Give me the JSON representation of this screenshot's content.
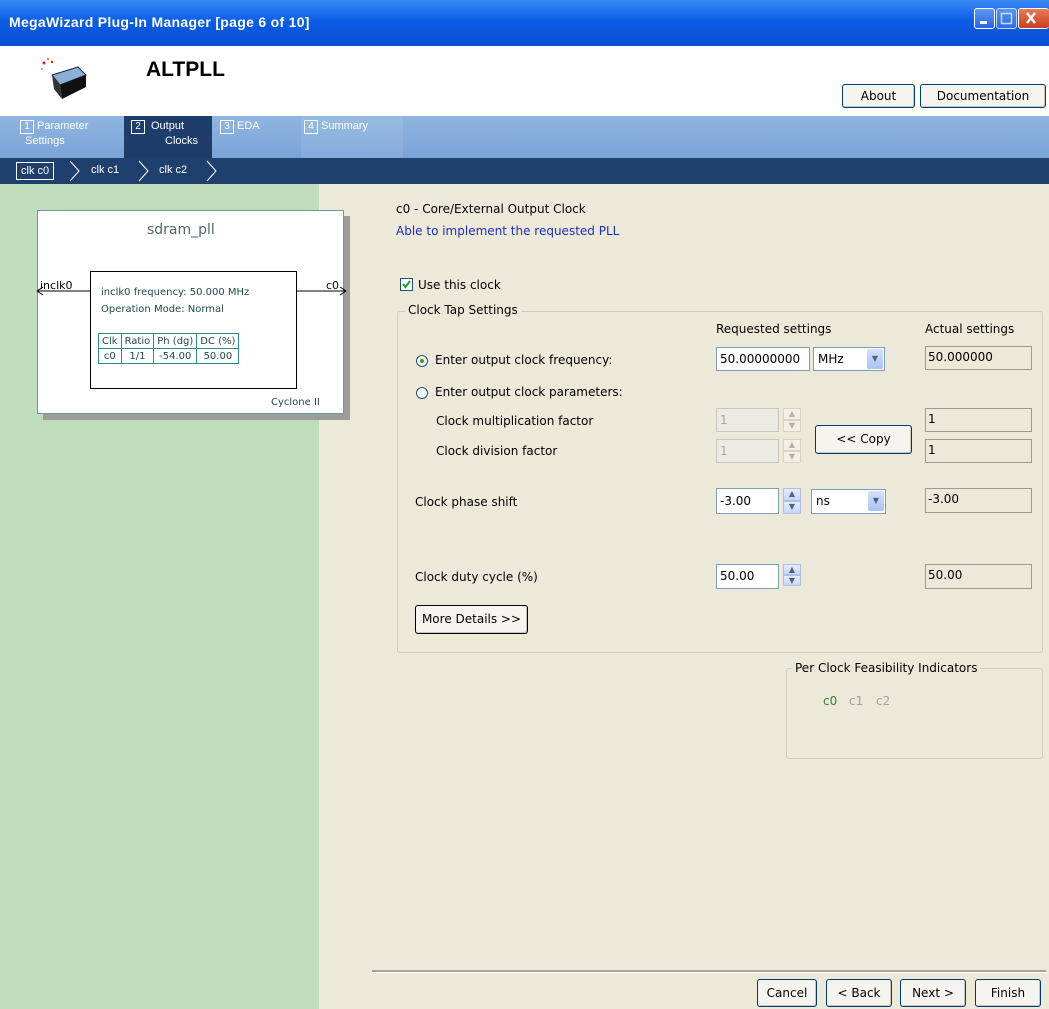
{
  "window": {
    "title": "MegaWizard Plug-In Manager [page 6 of 10]"
  },
  "header": {
    "app_title": "ALTPLL",
    "about_label": "About",
    "documentation_label": "Documentation"
  },
  "tabs": [
    {
      "num": "1",
      "line1": "Parameter",
      "line2": "Settings"
    },
    {
      "num": "2",
      "line1": "Output",
      "line2": "Clocks"
    },
    {
      "num": "3",
      "line1": "EDA",
      "line2": ""
    },
    {
      "num": "4",
      "line1": "Summary",
      "line2": ""
    }
  ],
  "subtabs": [
    "clk c0",
    "clk c1",
    "clk c2"
  ],
  "diagram": {
    "name": "sdram_pll",
    "input_port": "inclk0",
    "output_port": "c0",
    "freq_text": "inclk0 frequency: 50.000 MHz",
    "mode_text": "Operation Mode: Normal",
    "table_headers": [
      "Clk",
      "Ratio",
      "Ph (dg)",
      "DC (%)"
    ],
    "table_row": [
      "c0",
      "1/1",
      "-54.00",
      "50.00"
    ],
    "device": "Cyclone II"
  },
  "panel": {
    "heading": "c0 - Core/External Output Clock",
    "status": "Able to implement the requested PLL",
    "use_clock_label": "Use this clock",
    "group_title": "Clock Tap Settings",
    "req_header": "Requested settings",
    "act_header": "Actual settings",
    "opt_freq_label": "Enter output clock frequency:",
    "freq_value": "50.00000000",
    "freq_unit": "MHz",
    "freq_actual": "50.000000",
    "opt_params_label": "Enter output clock parameters:",
    "mult_label": "Clock multiplication factor",
    "mult_value": "1",
    "mult_actual": "1",
    "div_label": "Clock division factor",
    "div_value": "1",
    "div_actual": "1",
    "copy_label": "<< Copy",
    "phase_label": "Clock phase shift",
    "phase_value": "-3.00",
    "phase_unit": "ns",
    "phase_actual": "-3.00",
    "duty_label": "Clock duty cycle (%)",
    "duty_value": "50.00",
    "duty_actual": "50.00",
    "more_details_label": "More Details >>"
  },
  "feasibility": {
    "title": "Per Clock Feasibility Indicators",
    "items": [
      "c0",
      "c1",
      "c2"
    ],
    "colors": {
      "ok": "#2a8a2a",
      "inactive": "#a0a0a0"
    }
  },
  "footer": {
    "cancel": "Cancel",
    "back": "< Back",
    "next": "Next >",
    "finish": "Finish"
  }
}
